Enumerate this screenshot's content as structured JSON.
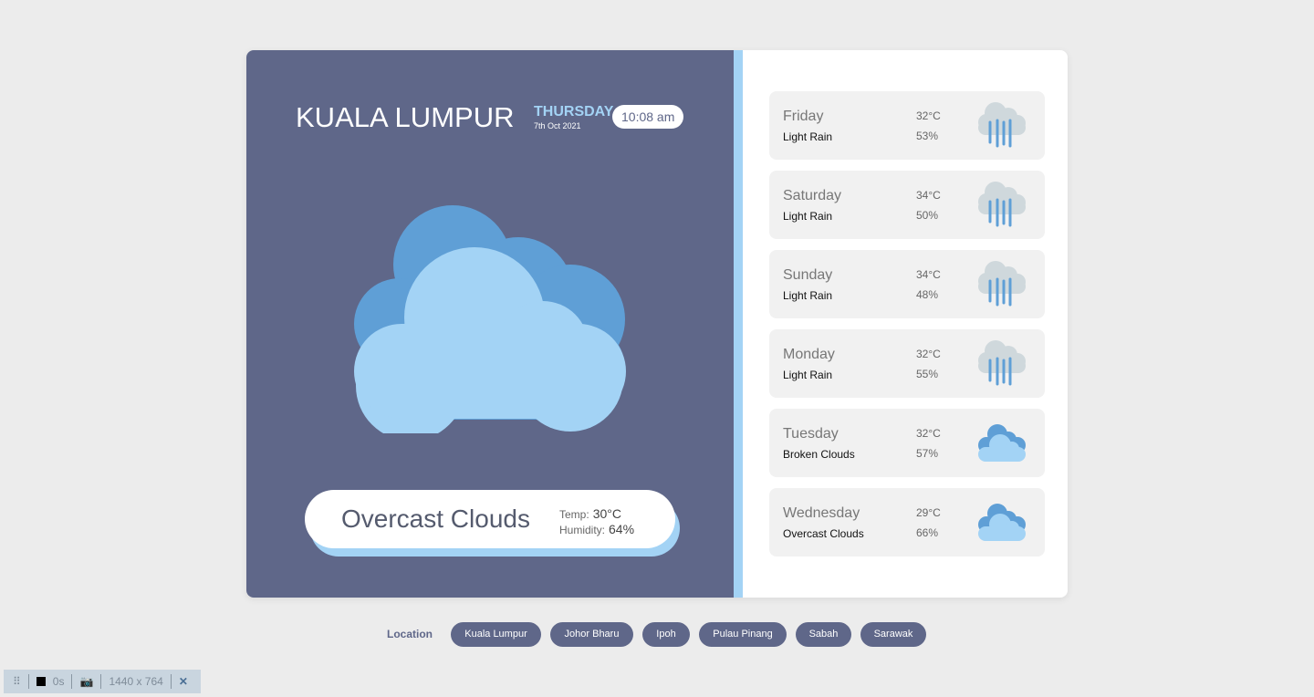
{
  "current": {
    "city": "KUALA LUMPUR",
    "day": "THURSDAY",
    "date": "7th Oct 2021",
    "time": "10:08 am",
    "condition": "Overcast Clouds",
    "temp_label": "Temp:",
    "temp": "30°C",
    "humidity_label": "Humidity:",
    "humidity": "64%"
  },
  "forecast": [
    {
      "day": "Friday",
      "condition": "Light Rain",
      "temp": "32°C",
      "humidity": "53%",
      "icon": "rain-icon"
    },
    {
      "day": "Saturday",
      "condition": "Light Rain",
      "temp": "34°C",
      "humidity": "50%",
      "icon": "rain-icon"
    },
    {
      "day": "Sunday",
      "condition": "Light Rain",
      "temp": "34°C",
      "humidity": "48%",
      "icon": "rain-icon"
    },
    {
      "day": "Monday",
      "condition": "Light Rain",
      "temp": "32°C",
      "humidity": "55%",
      "icon": "rain-icon"
    },
    {
      "day": "Tuesday",
      "condition": "Broken Clouds",
      "temp": "32°C",
      "humidity": "57%",
      "icon": "cloud-icon"
    },
    {
      "day": "Wednesday",
      "condition": "Overcast Clouds",
      "temp": "29°C",
      "humidity": "66%",
      "icon": "cloud-icon"
    }
  ],
  "locations": {
    "label": "Location",
    "items": [
      "Kuala Lumpur",
      "Johor Bharu",
      "Ipoh",
      "Pulau Pinang",
      "Sabah",
      "Sarawak"
    ]
  },
  "toolbar": {
    "timer": "0s",
    "size": "1440 x 764"
  },
  "colors": {
    "panel": "#5f6789",
    "accent": "#a3d3f5",
    "cloud_dark": "#5f9fd6"
  }
}
